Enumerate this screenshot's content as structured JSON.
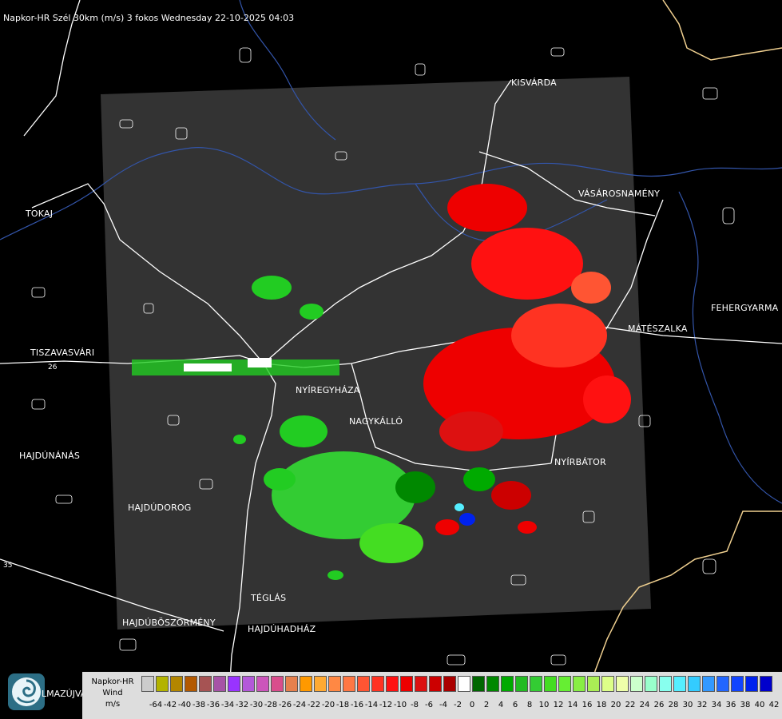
{
  "header": {
    "title": "Napkor-HR Szél 30km (m/s) 3 fokos Wednesday 22-10-2025 04:03"
  },
  "cities": [
    {
      "name": "KISVÁRDA"
    },
    {
      "name": "VÁSÁROSNAMÉNY"
    },
    {
      "name": "TOKAJ"
    },
    {
      "name": "FEHERGYARMA"
    },
    {
      "name": "MÁTÉSZALKA"
    },
    {
      "name": "TISZAVASVÁRI"
    },
    {
      "name": "NYÍREGYHÁZA"
    },
    {
      "name": "NAGYKÁLLÓ"
    },
    {
      "name": "NYÍRBÁTOR"
    },
    {
      "name": "HAJDÚNÁNÁS"
    },
    {
      "name": "HAJDÚDOROG"
    },
    {
      "name": "TÉGLÁS"
    },
    {
      "name": "HAJDÚBÖSZÖRMÉNY"
    },
    {
      "name": "HAJDÚHADHÁZ"
    }
  ],
  "road_labels": [
    "26",
    "35"
  ],
  "logo": {
    "text": "LMAZÚJVÁR",
    "icon": "weather-logo-icon"
  },
  "legend": {
    "title_lines": [
      "Napkor-HR",
      "Wind",
      "m/s"
    ],
    "labels": [
      "-64",
      "-42",
      "-40",
      "-38",
      "-36",
      "-34",
      "-32",
      "-30",
      "-28",
      "-26",
      "-24",
      "-22",
      "-20",
      "-18",
      "-16",
      "-14",
      "-12",
      "-10",
      "-8",
      "-6",
      "-4",
      "-2",
      "0",
      "2",
      "4",
      "6",
      "8",
      "10",
      "12",
      "14",
      "16",
      "18",
      "20",
      "22",
      "24",
      "26",
      "28",
      "30",
      "32",
      "34",
      "36",
      "38",
      "40",
      "42"
    ],
    "colors": [
      "#cccccc",
      "#b3b300",
      "#b38600",
      "#b35900",
      "#a65353",
      "#a653a6",
      "#9933ff",
      "#b359d9",
      "#cc55bb",
      "#d94d8c",
      "#e6804d",
      "#ff9900",
      "#ffaa33",
      "#ff8844",
      "#ff7744",
      "#ff5533",
      "#ff3322",
      "#ff1111",
      "#ee0000",
      "#dd1111",
      "#cc0000",
      "#aa0000",
      "#ffffff",
      "#006600",
      "#008800",
      "#00aa00",
      "#22bb22",
      "#33cc33",
      "#44dd22",
      "#66ee33",
      "#88ee44",
      "#aaee55",
      "#ddff88",
      "#eeffaa",
      "#ccffcc",
      "#99ffcc",
      "#88ffee",
      "#55eeff",
      "#33ccff",
      "#3399ff",
      "#2266ff",
      "#1144ff",
      "#0022ee",
      "#0000cc"
    ]
  },
  "colors": {
    "background": "#000000",
    "radar_area": "#333333",
    "positive_wind": "#22cc22",
    "negative_wind": "#ee1111",
    "roads": "#ffffff",
    "rivers": "#3355aa",
    "border": "#f0d090"
  }
}
